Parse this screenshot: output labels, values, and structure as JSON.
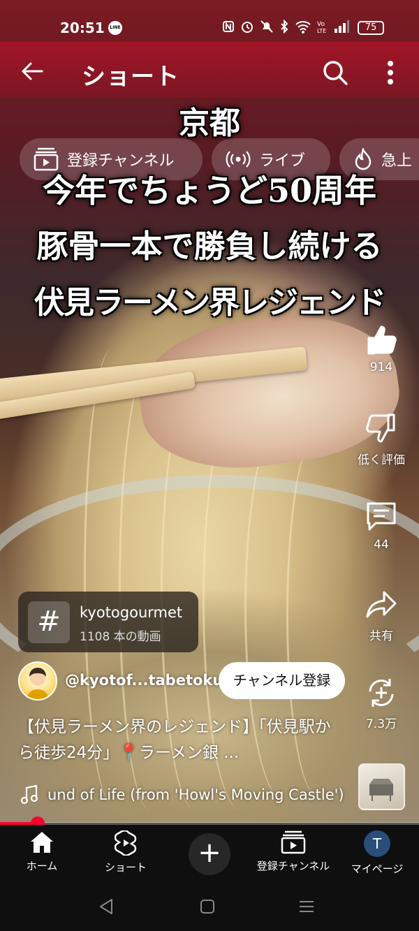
{
  "status_bar": {
    "time": "20:51",
    "line_badge": "LINE",
    "battery": "75",
    "icons": [
      "nfc-icon",
      "alarm-icon",
      "mute-icon",
      "bluetooth-icon",
      "wifi-icon",
      "volte-icon",
      "signal-icon"
    ]
  },
  "header": {
    "title": "ショート"
  },
  "chips": [
    {
      "label": "登録チャンネル",
      "icon": "subscriptions-icon"
    },
    {
      "label": "ライブ",
      "icon": "live-icon"
    },
    {
      "label": "急上",
      "icon": "trending-icon"
    }
  ],
  "captions": {
    "line1": "京都",
    "line2": "今年でちょうど50周年",
    "line3": "豚骨一本で勝負し続ける",
    "line4": "伏見ラーメン界レジェンド"
  },
  "actions": {
    "like_count": "914",
    "dislike_label": "低く評価",
    "comment_count": "44",
    "share_label": "共有",
    "remix_count": "7.3万"
  },
  "hashtag": {
    "symbol": "#",
    "name": "kyotogourmet",
    "count": "1108 本の動画"
  },
  "channel": {
    "handle": "@kyotof...tabetoku",
    "subscribe_label": "チャンネル登録"
  },
  "description": "【伏見ラーメン界のレジェンド】「伏見駅から徒歩24分」📍ラーメン銀 ...",
  "music": {
    "title": "und of Life (from 'Howl's Moving Castle')"
  },
  "progress": {
    "fraction": 0.09
  },
  "bottom_nav": {
    "home": "ホーム",
    "shorts": "ショート",
    "create": "+",
    "subscriptions": "登録チャンネル",
    "profile": "マイページ",
    "profile_initial": "T"
  },
  "colors": {
    "accent": "#ff0033",
    "header": "#aa1428",
    "nav_bg": "#0f0f0f"
  }
}
